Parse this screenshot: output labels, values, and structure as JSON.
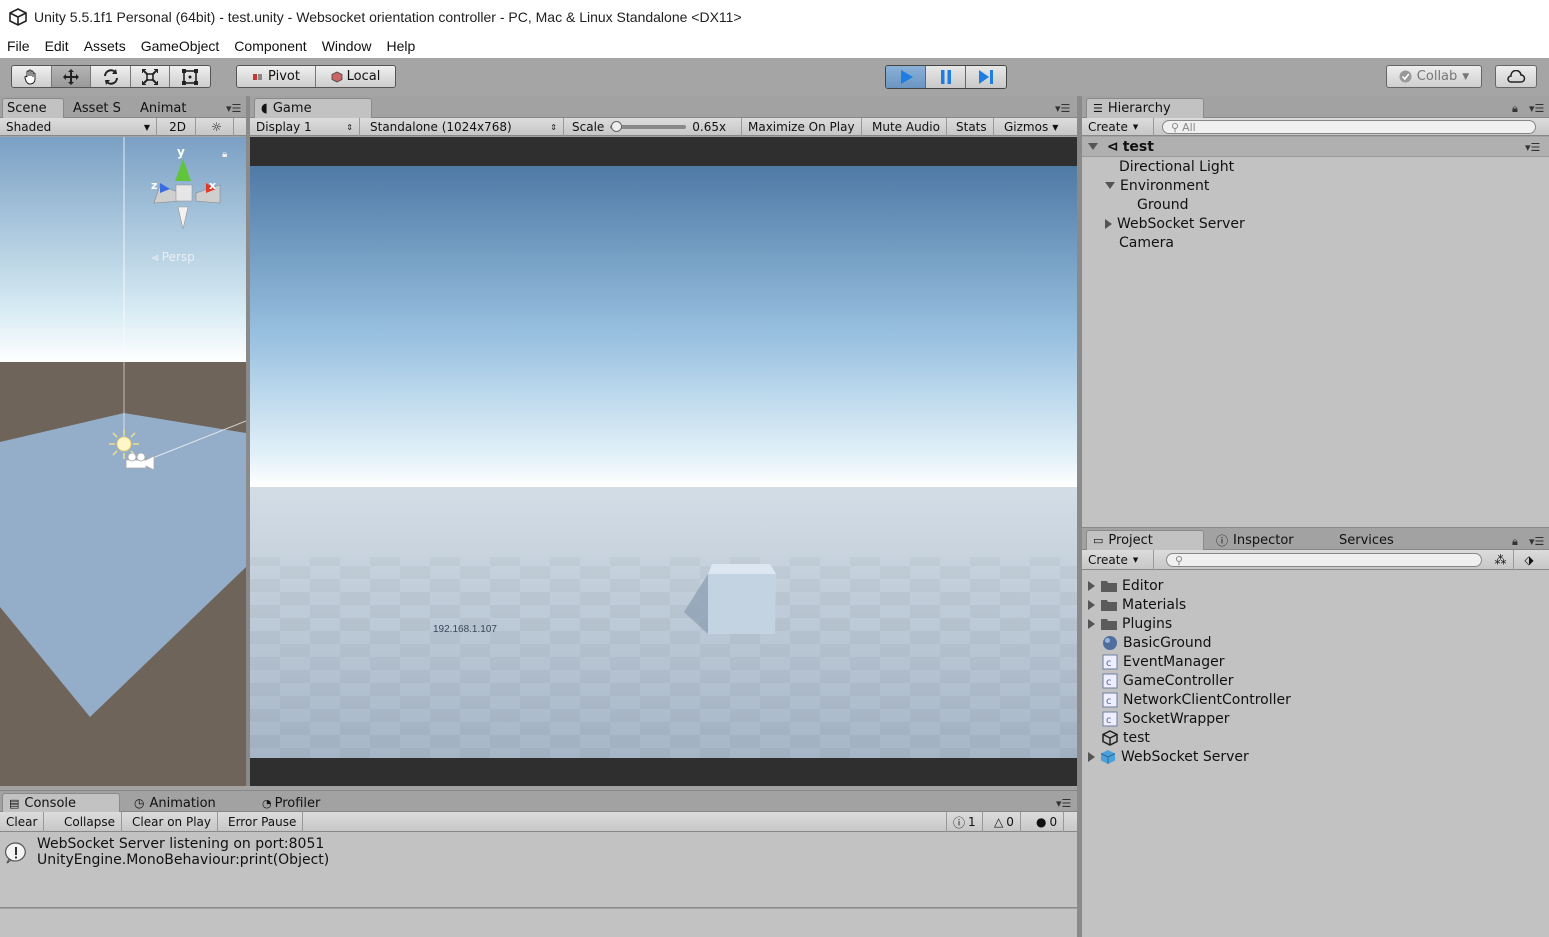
{
  "window": {
    "title": "Unity 5.5.1f1 Personal (64bit) - test.unity - Websocket orientation controller - PC, Mac & Linux Standalone <DX11>"
  },
  "menu": [
    "File",
    "Edit",
    "Assets",
    "GameObject",
    "Component",
    "Window",
    "Help"
  ],
  "toolbar": {
    "tools": [
      "hand-tool",
      "move-tool",
      "rotate-tool",
      "scale-tool",
      "rect-tool"
    ],
    "pivot_label": "Pivot",
    "local_label": "Local",
    "collab_label": "Collab",
    "active_tool": "move-tool"
  },
  "scene": {
    "tabs": [
      "Scene",
      "Asset S",
      "Animat"
    ],
    "shading": "Shaded",
    "mode2d": "2D",
    "persp_label": "Persp",
    "axis": {
      "y": "y",
      "z": "z",
      "x": "x"
    }
  },
  "game": {
    "tab": "Game",
    "display": "Display 1",
    "resolution": "Standalone (1024x768)",
    "scale_label": "Scale",
    "scale_value": "0.65x",
    "scale_fraction": 0.05,
    "buttons": [
      "Maximize On Play",
      "Mute Audio",
      "Stats",
      "Gizmos"
    ],
    "ip_text": "192.168.1.107"
  },
  "hierarchy": {
    "tab": "Hierarchy",
    "create": "Create",
    "search_placeholder": "All",
    "scene": "test",
    "items": [
      "Directional Light",
      "Environment",
      "Ground",
      "WebSocket Server",
      "Camera"
    ]
  },
  "project": {
    "tabs": [
      "Project",
      "Inspector",
      "Services"
    ],
    "create": "Create",
    "items": [
      "Editor",
      "Materials",
      "Plugins",
      "BasicGround",
      "EventManager",
      "GameController",
      "NetworkClientController",
      "SocketWrapper",
      "test",
      "WebSocket Server"
    ]
  },
  "console": {
    "tabs": [
      "Console",
      "Animation",
      "Profiler"
    ],
    "buttons": [
      "Clear",
      "Collapse",
      "Clear on Play",
      "Error Pause"
    ],
    "counts": {
      "info": "1",
      "warn": "0",
      "error": "0"
    },
    "messages": [
      {
        "line1": "WebSocket Server listening on port:8051",
        "line2": "UnityEngine.MonoBehaviour:print(Object)"
      }
    ]
  },
  "colors": {
    "play_active": "#6b96c2",
    "panel_bg": "#a2a2a2",
    "selected_tab": "#c2c2c2"
  }
}
